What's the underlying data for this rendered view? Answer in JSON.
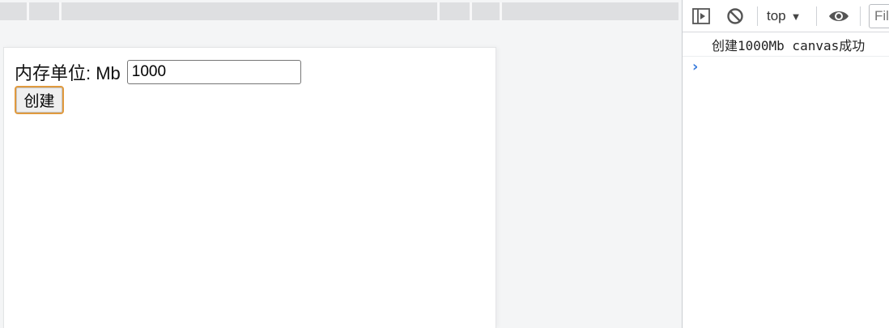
{
  "page": {
    "memory_label": "内存单位: Mb",
    "memory_input_value": "1000",
    "create_button_label": "创建"
  },
  "devtools": {
    "context_label": "top",
    "context_arrow": "▼",
    "filter_placeholder": "Filter",
    "messages": [
      {
        "text": "创建1000Mb canvas成功"
      }
    ],
    "prompt_symbol": "›",
    "icons": [
      "sidebar-toggle-icon",
      "clear-console-icon",
      "eye-icon"
    ]
  },
  "colors": {
    "button_focus_border": "#e09a3e",
    "prompt": "#3b7ddd"
  }
}
